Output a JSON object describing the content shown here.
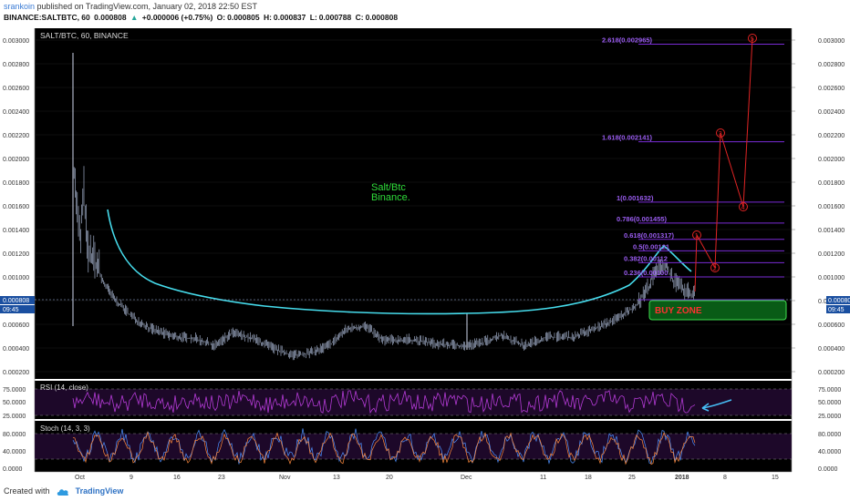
{
  "header": {
    "author": "srankoin",
    "published_text": "published on TradingView.com, January 02, 2018 22:50 EST",
    "symbol": "BINANCE:SALTBTC, 60",
    "last": "0.000808",
    "change": "+0.000006 (+0.75%)",
    "open_label": "O:",
    "open": "0.000805",
    "high_label": "H:",
    "high": "0.000837",
    "low_label": "L:",
    "low": "0.000788",
    "close_label": "C:",
    "close": "0.000808"
  },
  "chart": {
    "pane_title": "SALT/BTC, 60, BINANCE",
    "price_labels": [
      "0.003000",
      "0.002800",
      "0.002600",
      "0.002400",
      "0.002200",
      "0.002000",
      "0.001800",
      "0.001600",
      "0.001400",
      "0.001200",
      "0.001000",
      "0.000800",
      "0.000600",
      "0.000400",
      "0.000200"
    ],
    "current_price": "0.000808",
    "countdown": "09:45",
    "annotation_line1": "Salt/Btc",
    "annotation_line2": "Binance.",
    "buy_zone_label": "BUY ZONE",
    "fib_levels": [
      {
        "label": "2.618(0.002965)",
        "price": 0.002965
      },
      {
        "label": "1.618(0.002141)",
        "price": 0.002141
      },
      {
        "label": "1(0.001632)",
        "price": 0.001632
      },
      {
        "label": "0.786(0.001455)",
        "price": 0.001455
      },
      {
        "label": "0.618(0.001317)",
        "price": 0.001317
      },
      {
        "label": "0.5(0.00121",
        "price": 0.00122
      },
      {
        "label": "0.382(0.00112",
        "price": 0.00112
      },
      {
        "label": "0.236(0.00100",
        "price": 0.001
      },
      {
        "label": "",
        "price": 0.000808
      }
    ],
    "wave_labels": [
      "1",
      "2",
      "3",
      "4",
      "5"
    ],
    "x_labels": [
      "Oct",
      "9",
      "16",
      "23",
      "Nov",
      "13",
      "20",
      "Dec",
      "11",
      "18",
      "25",
      "2018",
      "8",
      "15"
    ],
    "rsi": {
      "title": "RSI (14, close)",
      "labels": [
        "75.0000",
        "50.0000",
        "25.0000"
      ]
    },
    "stoch": {
      "title": "Stoch (14, 3, 3)",
      "labels": [
        "80.0000",
        "40.0000",
        "0.0000"
      ]
    },
    "colors": {
      "background": "#000000",
      "candle": "#b9c7e6",
      "ma": "#46dcec",
      "fib": "#7a2bd6",
      "fib_text": "#9a5cf0",
      "wave": "#e02424",
      "buy_zone_fill": "#0b6b1a",
      "buy_zone_border": "#3fdc4f",
      "buy_zone_text": "#ff3030",
      "annotation": "#2fdc3a",
      "rsi": "#b43bd6",
      "stoch_k": "#4d90fe",
      "stoch_d": "#ff8a3c",
      "arrow": "#46bdf5"
    }
  },
  "footer": {
    "created_with": "Created with",
    "brand": "TradingView"
  }
}
